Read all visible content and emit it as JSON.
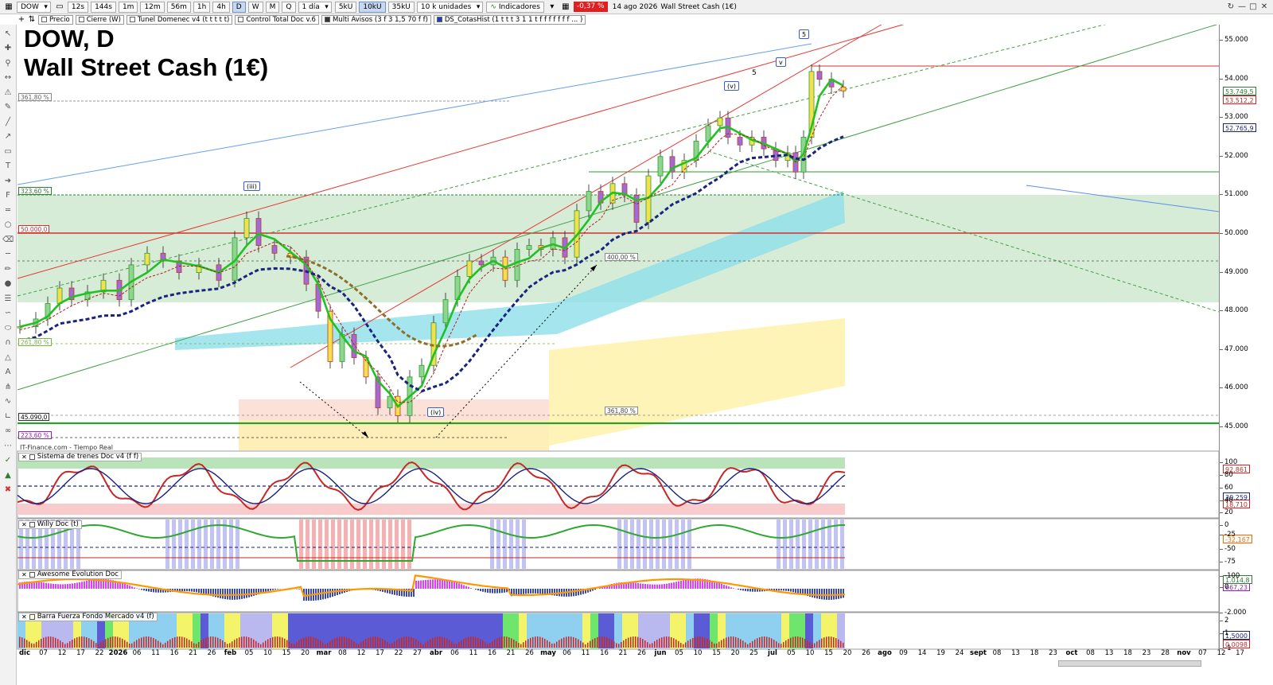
{
  "toolbar": {
    "symbol": "DOW",
    "timeframes": [
      "12s",
      "144s",
      "1m",
      "12m",
      "56m",
      "1h",
      "4h",
      "D",
      "W",
      "M",
      "Q"
    ],
    "period": "1 día",
    "volumes": [
      "5kU",
      "10kU",
      "35kU"
    ],
    "units": "10 k unidades",
    "indicators_label": "Indicadores",
    "change_pct": "-0,37 %",
    "date": "14 ago 2026",
    "instrument": "Wall Street Cash (1€)"
  },
  "chips": [
    "Precio",
    "Cierre (W)",
    "Tunel Domenec v4 (t t t t t)",
    "Control Total Doc v.6",
    "Multi Avisos (3 f 3 1,5 70 f f)",
    "DS_CotasHist (1 t t t 3 1 1 t f f f f f f f ... )"
  ],
  "chart": {
    "title_line1": "DOW, D",
    "title_line2": "Wall Street Cash (1€)",
    "provider": "IT-Finance.com - Tiempo Real",
    "price_labels": [
      "55.000",
      "54.000",
      "53.000",
      "52.000",
      "51.000",
      "50.000",
      "49.000",
      "48.000",
      "47.000",
      "46.000",
      "45.000"
    ],
    "price_tags": {
      "last": "53.749,5",
      "last_color": "#2e7d32",
      "ref": "53.512,2",
      "ref_color": "#c62828",
      "ma": "52.765,9",
      "ma_color": "#1a237e"
    },
    "level_tags": {
      "t361_top": "361,80 %",
      "t323": "323,60 %",
      "t50000": "50.000,0",
      "t261": "261,80 %",
      "t45090": "45.090,0",
      "t223": "223,60 %",
      "t400": "400,00 %",
      "t361_mid": "361,80 %"
    },
    "waves": {
      "w5": "5",
      "wv": "v",
      "w5b": "5",
      "wv2": "(v)",
      "wiii": "(iii)",
      "wiv": "(iv)"
    }
  },
  "panes": {
    "p1": {
      "title": "Sistema de trenes Doc v4 (f f)",
      "labels": [
        "100",
        "80",
        "60",
        "40",
        "20",
        "0"
      ],
      "tag_a": "92,861",
      "tag_b": "30,259",
      "tag_c": "18,710"
    },
    "p2": {
      "title": "Willy Doc (t)",
      "labels": [
        "-25",
        "-50",
        "-75",
        "-100"
      ],
      "tag_a": "-32,167"
    },
    "p3": {
      "title": "Awesome Evolution Doc",
      "labels": [
        "0",
        "-2.000"
      ],
      "tag_a": "667,23",
      "tag_b": "1.014,8"
    },
    "p4": {
      "title": "Barra Fuerza Fondo Mercado v4 (f)",
      "labels": [
        "2",
        "1",
        "-1"
      ],
      "tag_a": "0,0098",
      "tag_b": "1,5000"
    }
  },
  "dates": [
    {
      "t": "dic",
      "b": true
    },
    {
      "t": "07"
    },
    {
      "t": "12"
    },
    {
      "t": "17"
    },
    {
      "t": "22"
    },
    {
      "t": "2026",
      "b": true
    },
    {
      "t": "06"
    },
    {
      "t": "11"
    },
    {
      "t": "16"
    },
    {
      "t": "21"
    },
    {
      "t": "26"
    },
    {
      "t": "feb",
      "b": true
    },
    {
      "t": "05"
    },
    {
      "t": "10"
    },
    {
      "t": "15"
    },
    {
      "t": "20"
    },
    {
      "t": "mar",
      "b": true
    },
    {
      "t": "08"
    },
    {
      "t": "12"
    },
    {
      "t": "17"
    },
    {
      "t": "22"
    },
    {
      "t": "27"
    },
    {
      "t": "abr",
      "b": true
    },
    {
      "t": "06"
    },
    {
      "t": "11"
    },
    {
      "t": "16"
    },
    {
      "t": "21"
    },
    {
      "t": "26"
    },
    {
      "t": "may",
      "b": true
    },
    {
      "t": "06"
    },
    {
      "t": "11"
    },
    {
      "t": "16"
    },
    {
      "t": "21"
    },
    {
      "t": "26"
    },
    {
      "t": "jun",
      "b": true
    },
    {
      "t": "05"
    },
    {
      "t": "10"
    },
    {
      "t": "15"
    },
    {
      "t": "20"
    },
    {
      "t": "25"
    },
    {
      "t": "jul",
      "b": true
    },
    {
      "t": "05"
    },
    {
      "t": "10"
    },
    {
      "t": "15"
    },
    {
      "t": "20"
    },
    {
      "t": "26"
    },
    {
      "t": "ago",
      "b": true
    },
    {
      "t": "09"
    },
    {
      "t": "14"
    },
    {
      "t": "19"
    },
    {
      "t": "24"
    },
    {
      "t": "sept",
      "b": true
    },
    {
      "t": "08"
    },
    {
      "t": "13"
    },
    {
      "t": "18"
    },
    {
      "t": "23"
    },
    {
      "t": "oct",
      "b": true
    },
    {
      "t": "08"
    },
    {
      "t": "13"
    },
    {
      "t": "18"
    },
    {
      "t": "23"
    },
    {
      "t": "28"
    },
    {
      "t": "nov",
      "b": true
    },
    {
      "t": "07"
    },
    {
      "t": "12"
    },
    {
      "t": "17"
    }
  ],
  "colors": {
    "up": "#2e9e2e",
    "down": "#c0392b",
    "ma_blue": "#1a237e",
    "zone_green": "#c8e6c9",
    "zone_cyan": "#8ee0ea",
    "zone_yellow": "#fff3b0",
    "zone_salmon": "#f8c9b8"
  }
}
